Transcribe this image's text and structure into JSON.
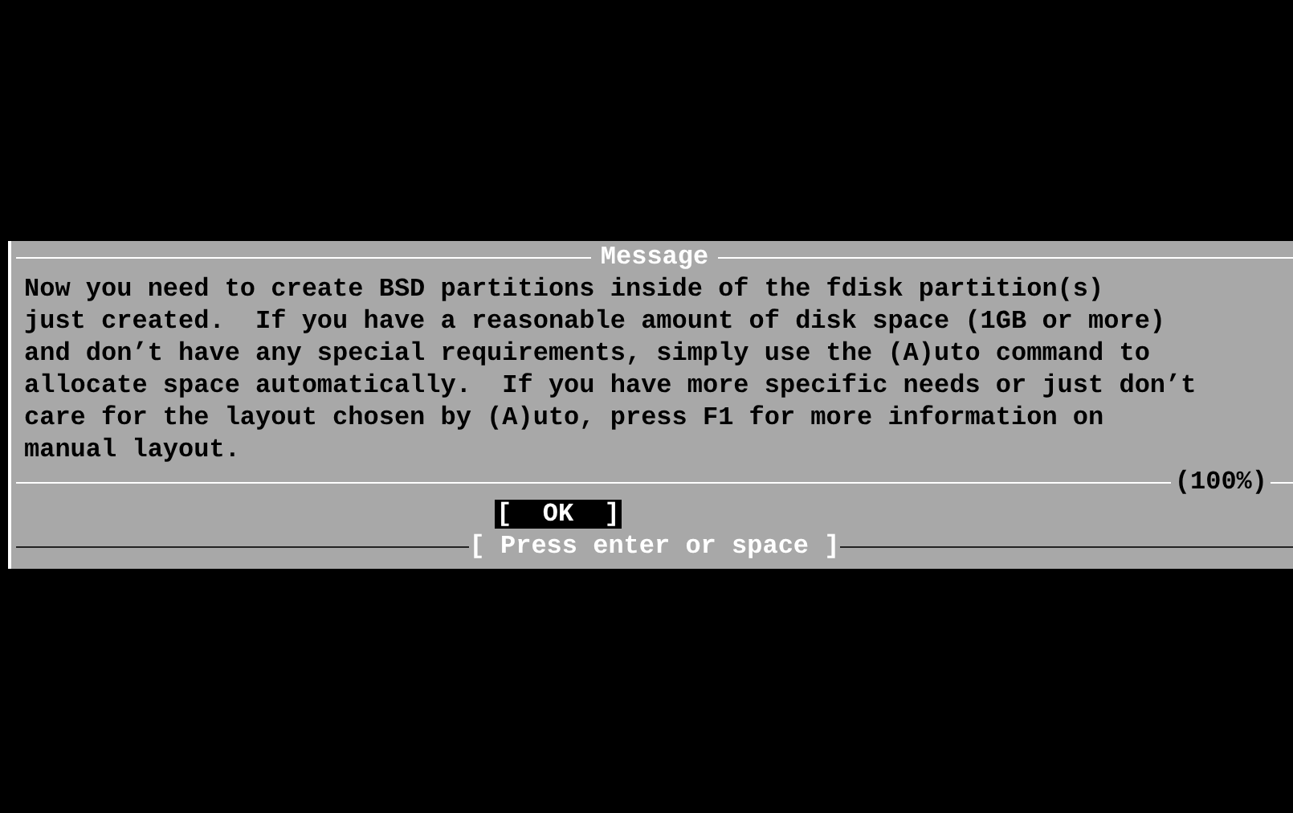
{
  "dialog": {
    "title": "Message",
    "lines": [
      "Now you need to create BSD partitions inside of the fdisk partition(s)",
      "just created.  If you have a reasonable amount of disk space (1GB or more)",
      "and don’t have any special requirements, simply use the (A)uto command to",
      "allocate space automatically.  If you have more specific needs or just don’t",
      "care for the layout chosen by (A)uto, press F1 for more information on",
      "manual layout."
    ],
    "progress": "(100%)",
    "buttons": [
      {
        "label": "[  OK  ]",
        "selected": true
      }
    ],
    "hint": "[ Press enter or space ]"
  }
}
